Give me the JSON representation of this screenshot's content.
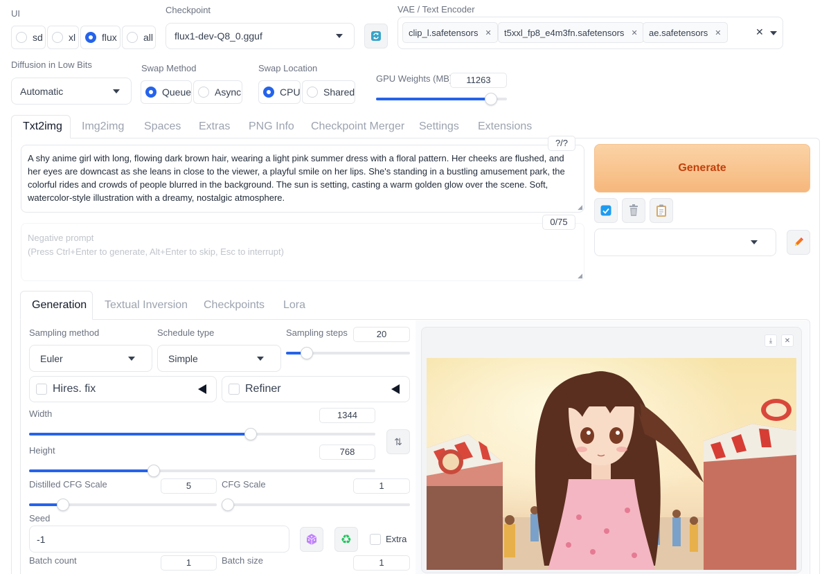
{
  "ui": {
    "label": "UI",
    "options": [
      "sd",
      "xl",
      "flux",
      "all"
    ],
    "selected": "flux"
  },
  "checkpoint": {
    "label": "Checkpoint",
    "value": "flux1-dev-Q8_0.gguf"
  },
  "vae": {
    "label": "VAE / Text Encoder",
    "chips": [
      "clip_l.safetensors",
      "t5xxl_fp8_e4m3fn.safetensors",
      "ae.safetensors"
    ]
  },
  "diffusion": {
    "label": "Diffusion in Low Bits",
    "value": "Automatic"
  },
  "swap_method": {
    "label": "Swap Method",
    "options": [
      "Queue",
      "Async"
    ],
    "selected": "Queue"
  },
  "swap_location": {
    "label": "Swap Location",
    "options": [
      "CPU",
      "Shared"
    ],
    "selected": "CPU"
  },
  "gpu_weights": {
    "label": "GPU Weights (MB)",
    "value": "11263",
    "fraction": 0.88
  },
  "main_tabs": [
    "Txt2img",
    "Img2img",
    "Spaces",
    "Extras",
    "PNG Info",
    "Checkpoint Merger",
    "Settings",
    "Extensions"
  ],
  "prompt": {
    "text": "A shy anime girl with long, flowing dark brown hair, wearing a light pink summer dress with a floral pattern. Her cheeks are flushed, and her eyes are downcast as she leans in close to the viewer, a playful smile on her lips. She's standing in a bustling amusement park, the colorful rides and crowds of people blurred in the background. The sun is setting, casting a warm golden glow over the scene. Soft, watercolor-style illustration with a dreamy, nostalgic atmosphere.",
    "token_count": "?/?"
  },
  "negative": {
    "placeholder": "Negative prompt\n(Press Ctrl+Enter to generate, Alt+Enter to skip, Esc to interrupt)",
    "token_count": "0/75"
  },
  "generate_label": "Generate",
  "sub_tabs": [
    "Generation",
    "Textual Inversion",
    "Checkpoints",
    "Lora"
  ],
  "sampling_method": {
    "label": "Sampling method",
    "value": "Euler"
  },
  "schedule_type": {
    "label": "Schedule type",
    "value": "Simple"
  },
  "sampling_steps": {
    "label": "Sampling steps",
    "value": "20",
    "fraction": 0.17
  },
  "hires": {
    "label": "Hires. fix"
  },
  "refiner": {
    "label": "Refiner"
  },
  "width": {
    "label": "Width",
    "value": "1344",
    "fraction": 0.64
  },
  "height": {
    "label": "Height",
    "value": "768",
    "fraction": 0.36
  },
  "distilled_cfg": {
    "label": "Distilled CFG Scale",
    "value": "5",
    "fraction": 0.18
  },
  "cfg": {
    "label": "CFG Scale",
    "value": "1",
    "fraction": 0.0
  },
  "seed": {
    "label": "Seed",
    "value": "-1",
    "extra_label": "Extra"
  },
  "batch_count": {
    "label": "Batch count",
    "value": "1"
  },
  "batch_size": {
    "label": "Batch size",
    "value": "1"
  },
  "colors": {
    "accent": "#2563eb",
    "generate_bg": "#f9c48c",
    "generate_text": "#c2410c"
  },
  "icons": [
    "refresh-icon",
    "close-icon",
    "chevron-down-icon",
    "checkbox-icon",
    "trash-icon",
    "clipboard-icon",
    "pencil-icon",
    "swap-icon",
    "dice-icon",
    "recycle-icon",
    "download-icon"
  ]
}
